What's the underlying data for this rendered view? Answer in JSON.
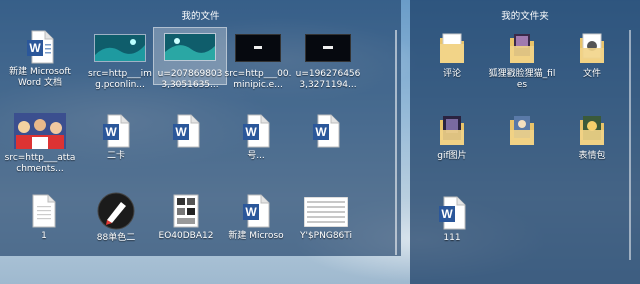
{
  "left_panel": {
    "title": "我的文件",
    "items": [
      {
        "type": "word",
        "label": "新建 Microsoft Word 文档"
      },
      {
        "type": "image-teal",
        "label": "src=http___img.pconlin..."
      },
      {
        "type": "image-teal",
        "label": "u=2078698033,3051635..."
      },
      {
        "type": "image-dark",
        "label": "src=http___00.minipic.e..."
      },
      {
        "type": "image-dark",
        "label": "u=1962764563,3271194..."
      },
      {
        "type": "image-photo",
        "label": "src=http___attachments..."
      },
      {
        "type": "word",
        "label": "二卡"
      },
      {
        "type": "word",
        "label": ""
      },
      {
        "type": "word",
        "label": "号..."
      },
      {
        "type": "word",
        "label": ""
      },
      {
        "type": "file",
        "label": "1"
      },
      {
        "type": "pen",
        "label": "88单色二"
      },
      {
        "type": "doc-thumb",
        "label": "EO40DBA12"
      },
      {
        "type": "word",
        "label": "新建 Microso"
      },
      {
        "type": "doc-table",
        "label": "Y'$PNG86Ti"
      }
    ]
  },
  "right_panel": {
    "title": "我的文件夹",
    "items": [
      {
        "type": "folder",
        "label": "评论"
      },
      {
        "type": "folder-content",
        "label": "狐狸戳脸狸猫_files"
      },
      {
        "type": "folder-docs",
        "label": "文件"
      },
      {
        "type": "folder-pic",
        "label": "gif图片"
      },
      {
        "type": "folder-pic2",
        "label": ""
      },
      {
        "type": "folder-pic3",
        "label": "表情包"
      },
      {
        "type": "word",
        "label": "111"
      }
    ]
  },
  "colors": {
    "accent_word": "#2b579a",
    "fence": "#183a62",
    "folder": "#e9c46a"
  }
}
